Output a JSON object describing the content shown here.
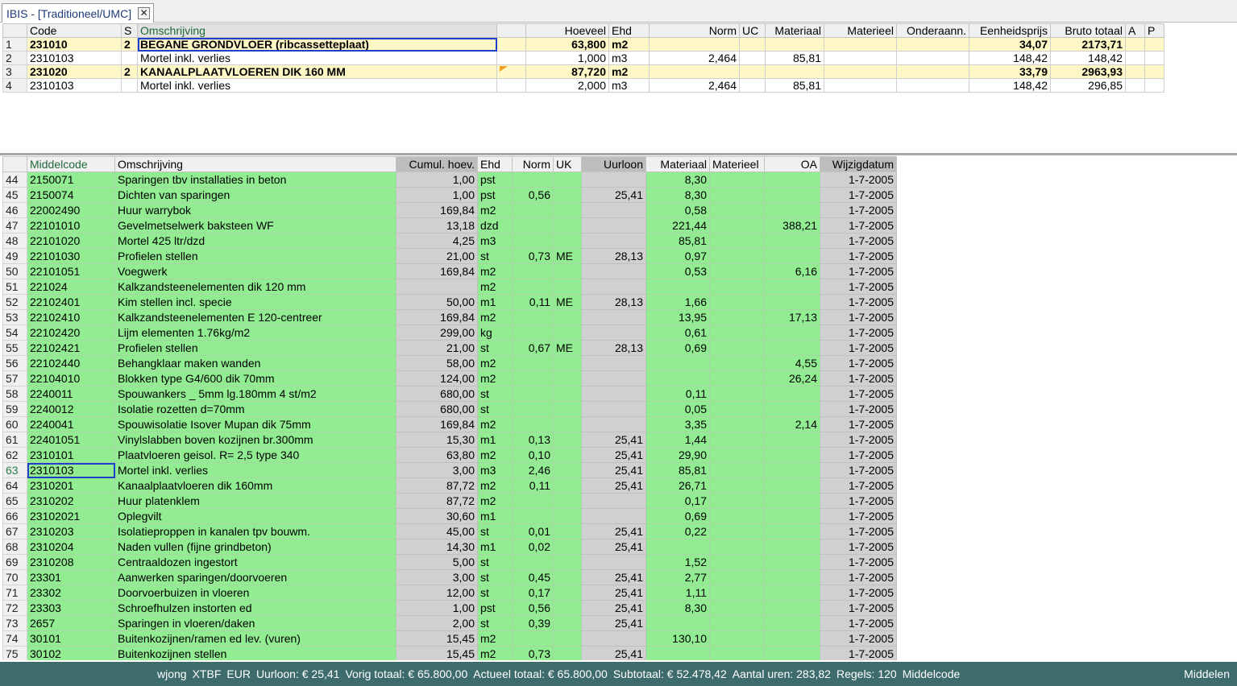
{
  "tab": {
    "title": "IBIS - [Traditioneel/UMC]",
    "close_glyph": "✕",
    "close_icon": "close-icon"
  },
  "upper_grid": {
    "columns": [
      {
        "key": "row",
        "label": "",
        "align": "l",
        "width": 30
      },
      {
        "key": "code",
        "label": "Code",
        "align": "l",
        "width": 117
      },
      {
        "key": "s",
        "label": "S",
        "align": "l",
        "width": 20
      },
      {
        "key": "omschrijving",
        "label": "Omschrijving",
        "align": "l",
        "width": 446,
        "sorted": true
      },
      {
        "key": "marker",
        "label": "",
        "align": "l",
        "width": 36
      },
      {
        "key": "hoeveel",
        "label": "Hoeveel",
        "align": "r",
        "width": 103
      },
      {
        "key": "ehd",
        "label": "Ehd",
        "align": "l",
        "width": 50
      },
      {
        "key": "norm",
        "label": "Norm",
        "align": "r",
        "width": 112
      },
      {
        "key": "uc",
        "label": "UC",
        "align": "l",
        "width": 32
      },
      {
        "key": "materiaal",
        "label": "Materiaal",
        "align": "r",
        "width": 73
      },
      {
        "key": "materieel",
        "label": "Materieel",
        "align": "r",
        "width": 90
      },
      {
        "key": "onderaann",
        "label": "Onderaann.",
        "align": "r",
        "width": 90
      },
      {
        "key": "eenheidsprijs",
        "label": "Eenheidsprijs",
        "align": "r",
        "width": 101
      },
      {
        "key": "bruto_totaal",
        "label": "Bruto totaal",
        "align": "r",
        "width": 93
      },
      {
        "key": "a",
        "label": "A",
        "align": "l",
        "width": 24
      },
      {
        "key": "p",
        "label": "P",
        "align": "l",
        "width": 24
      }
    ],
    "rows": [
      {
        "row": "1",
        "code": "231010",
        "s": "2",
        "omschrijving": "BEGANE GRONDVLOER (ribcassetteplaat)",
        "marker": "",
        "hoeveel": "63,800",
        "ehd": "m2",
        "norm": "",
        "uc": "",
        "materiaal": "",
        "materieel": "",
        "onderaann": "",
        "eenheidsprijs": "34,07",
        "bruto_totaal": "2173,71",
        "a": "",
        "p": "",
        "heading": true,
        "selected": "omschrijving"
      },
      {
        "row": "2",
        "code": "2310103",
        "s": "",
        "omschrijving": "Mortel inkl. verlies",
        "marker": "",
        "hoeveel": "1,000",
        "ehd": "m3",
        "norm": "2,464",
        "uc": "",
        "materiaal": "85,81",
        "materieel": "",
        "onderaann": "",
        "eenheidsprijs": "148,42",
        "bruto_totaal": "148,42",
        "a": "",
        "p": ""
      },
      {
        "row": "3",
        "code": "231020",
        "s": "2",
        "omschrijving": "KANAALPLAATVLOEREN  DIK 160 MM",
        "marker": "note",
        "hoeveel": "87,720",
        "ehd": "m2",
        "norm": "",
        "uc": "",
        "materiaal": "",
        "materieel": "",
        "onderaann": "",
        "eenheidsprijs": "33,79",
        "bruto_totaal": "2963,93",
        "a": "",
        "p": "",
        "heading": true
      },
      {
        "row": "4",
        "code": "2310103",
        "s": "",
        "omschrijving": "Mortel inkl. verlies",
        "marker": "",
        "hoeveel": "2,000",
        "ehd": "m3",
        "norm": "2,464",
        "uc": "",
        "materiaal": "85,81",
        "materieel": "",
        "onderaann": "",
        "eenheidsprijs": "148,42",
        "bruto_totaal": "296,85",
        "a": "",
        "p": ""
      }
    ]
  },
  "lower_grid": {
    "columns": [
      {
        "key": "row",
        "label": "",
        "align": "l",
        "width": 30
      },
      {
        "key": "middelcode",
        "label": "Middelcode",
        "align": "l",
        "width": 109,
        "sorted": true
      },
      {
        "key": "omschrijving",
        "label": "Omschrijving",
        "align": "l",
        "width": 349
      },
      {
        "key": "cumul",
        "label": "Cumul. hoev.",
        "align": "r",
        "width": 101,
        "dark": true
      },
      {
        "key": "ehd",
        "label": "Ehd",
        "align": "l",
        "width": 43
      },
      {
        "key": "norm",
        "label": "Norm",
        "align": "r",
        "width": 51
      },
      {
        "key": "uk",
        "label": "UK",
        "align": "l",
        "width": 35
      },
      {
        "key": "uurloon",
        "label": "Uurloon",
        "align": "r",
        "width": 80,
        "dark": true
      },
      {
        "key": "materiaal",
        "label": "Materiaal",
        "align": "r",
        "width": 79
      },
      {
        "key": "materieel",
        "label": "Materieel",
        "align": "l",
        "width": 68
      },
      {
        "key": "oa",
        "label": "OA",
        "align": "r",
        "width": 69
      },
      {
        "key": "wijzigdatum",
        "label": "Wijzigdatum",
        "align": "r",
        "width": 95,
        "dark": true
      }
    ],
    "rows": [
      {
        "row": "44",
        "middelcode": "2150071",
        "omschrijving": "Sparingen tbv installaties in beton",
        "cumul": "1,00",
        "ehd": "pst",
        "norm": "",
        "uk": "",
        "uurloon": "",
        "materiaal": "8,30",
        "materieel": "",
        "oa": "",
        "wijzigdatum": "1-7-2005"
      },
      {
        "row": "45",
        "middelcode": "2150074",
        "omschrijving": "Dichten van sparingen",
        "cumul": "1,00",
        "ehd": "pst",
        "norm": "0,56",
        "uk": "",
        "uurloon": "25,41",
        "materiaal": "8,30",
        "materieel": "",
        "oa": "",
        "wijzigdatum": "1-7-2005"
      },
      {
        "row": "46",
        "middelcode": "22002490",
        "omschrijving": "Huur warrybok",
        "cumul": "169,84",
        "ehd": "m2",
        "norm": "",
        "uk": "",
        "uurloon": "",
        "materiaal": "0,58",
        "materieel": "",
        "oa": "",
        "wijzigdatum": "1-7-2005"
      },
      {
        "row": "47",
        "middelcode": "22101010",
        "omschrijving": "Gevelmetselwerk baksteen WF",
        "cumul": "13,18",
        "ehd": "dzd",
        "norm": "",
        "uk": "",
        "uurloon": "",
        "materiaal": "221,44",
        "materieel": "",
        "oa": "388,21",
        "wijzigdatum": "1-7-2005"
      },
      {
        "row": "48",
        "middelcode": "22101020",
        "omschrijving": "Mortel 425 ltr/dzd",
        "cumul": "4,25",
        "ehd": "m3",
        "norm": "",
        "uk": "",
        "uurloon": "",
        "materiaal": "85,81",
        "materieel": "",
        "oa": "",
        "wijzigdatum": "1-7-2005"
      },
      {
        "row": "49",
        "middelcode": "22101030",
        "omschrijving": "Profielen stellen",
        "cumul": "21,00",
        "ehd": "st",
        "norm": "0,73",
        "uk": "ME",
        "uurloon": "28,13",
        "materiaal": "0,97",
        "materieel": "",
        "oa": "",
        "wijzigdatum": "1-7-2005"
      },
      {
        "row": "50",
        "middelcode": "22101051",
        "omschrijving": "Voegwerk",
        "cumul": "169,84",
        "ehd": "m2",
        "norm": "",
        "uk": "",
        "uurloon": "",
        "materiaal": "0,53",
        "materieel": "",
        "oa": "6,16",
        "wijzigdatum": "1-7-2005"
      },
      {
        "row": "51",
        "middelcode": "221024",
        "omschrijving": "Kalkzandsteenelementen dik 120 mm",
        "cumul": "",
        "ehd": "m2",
        "norm": "",
        "uk": "",
        "uurloon": "",
        "materiaal": "",
        "materieel": "",
        "oa": "",
        "wijzigdatum": "1-7-2005"
      },
      {
        "row": "52",
        "middelcode": "22102401",
        "omschrijving": "Kim stellen incl. specie",
        "cumul": "50,00",
        "ehd": "m1",
        "norm": "0,11",
        "uk": "ME",
        "uurloon": "28,13",
        "materiaal": "1,66",
        "materieel": "",
        "oa": "",
        "wijzigdatum": "1-7-2005"
      },
      {
        "row": "53",
        "middelcode": "22102410",
        "omschrijving": "Kalkzandsteenelementen E 120-centreer",
        "cumul": "169,84",
        "ehd": "m2",
        "norm": "",
        "uk": "",
        "uurloon": "",
        "materiaal": "13,95",
        "materieel": "",
        "oa": "17,13",
        "wijzigdatum": "1-7-2005"
      },
      {
        "row": "54",
        "middelcode": "22102420",
        "omschrijving": "Lijm elementen 1.76kg/m2",
        "cumul": "299,00",
        "ehd": "kg",
        "norm": "",
        "uk": "",
        "uurloon": "",
        "materiaal": "0,61",
        "materieel": "",
        "oa": "",
        "wijzigdatum": "1-7-2005"
      },
      {
        "row": "55",
        "middelcode": "22102421",
        "omschrijving": "Profielen stellen",
        "cumul": "21,00",
        "ehd": "st",
        "norm": "0,67",
        "uk": "ME",
        "uurloon": "28,13",
        "materiaal": "0,69",
        "materieel": "",
        "oa": "",
        "wijzigdatum": "1-7-2005"
      },
      {
        "row": "56",
        "middelcode": "22102440",
        "omschrijving": "Behangklaar maken wanden",
        "cumul": "58,00",
        "ehd": "m2",
        "norm": "",
        "uk": "",
        "uurloon": "",
        "materiaal": "",
        "materieel": "",
        "oa": "4,55",
        "wijzigdatum": "1-7-2005"
      },
      {
        "row": "57",
        "middelcode": "22104010",
        "omschrijving": "Blokken type G4/600 dik  70mm",
        "cumul": "124,00",
        "ehd": "m2",
        "norm": "",
        "uk": "",
        "uurloon": "",
        "materiaal": "",
        "materieel": "",
        "oa": "26,24",
        "wijzigdatum": "1-7-2005"
      },
      {
        "row": "58",
        "middelcode": "2240011",
        "omschrijving": "Spouwankers _ 5mm lg.180mm      4 st/m2",
        "cumul": "680,00",
        "ehd": "st",
        "norm": "",
        "uk": "",
        "uurloon": "",
        "materiaal": "0,11",
        "materieel": "",
        "oa": "",
        "wijzigdatum": "1-7-2005"
      },
      {
        "row": "59",
        "middelcode": "2240012",
        "omschrijving": "Isolatie rozetten d=70mm",
        "cumul": "680,00",
        "ehd": "st",
        "norm": "",
        "uk": "",
        "uurloon": "",
        "materiaal": "0,05",
        "materieel": "",
        "oa": "",
        "wijzigdatum": "1-7-2005"
      },
      {
        "row": "60",
        "middelcode": "2240041",
        "omschrijving": "Spouwisolatie Isover Mupan  dik 75mm",
        "cumul": "169,84",
        "ehd": "m2",
        "norm": "",
        "uk": "",
        "uurloon": "",
        "materiaal": "3,35",
        "materieel": "",
        "oa": "2,14",
        "wijzigdatum": "1-7-2005"
      },
      {
        "row": "61",
        "middelcode": "22401051",
        "omschrijving": "Vinylslabben  boven kozijnen br.300mm",
        "cumul": "15,30",
        "ehd": "m1",
        "norm": "0,13",
        "uk": "",
        "uurloon": "25,41",
        "materiaal": "1,44",
        "materieel": "",
        "oa": "",
        "wijzigdatum": "1-7-2005"
      },
      {
        "row": "62",
        "middelcode": "2310101",
        "omschrijving": "Plaatvloeren geisol. R= 2,5 type 340",
        "cumul": "63,80",
        "ehd": "m2",
        "norm": "0,10",
        "uk": "",
        "uurloon": "25,41",
        "materiaal": "29,90",
        "materieel": "",
        "oa": "",
        "wijzigdatum": "1-7-2005"
      },
      {
        "row": "63",
        "middelcode": "2310103",
        "omschrijving": "Mortel inkl. verlies",
        "cumul": "3,00",
        "ehd": "m3",
        "norm": "2,46",
        "uk": "",
        "uurloon": "25,41",
        "materiaal": "85,81",
        "materieel": "",
        "oa": "",
        "wijzigdatum": "1-7-2005",
        "current": true,
        "selected": "middelcode"
      },
      {
        "row": "64",
        "middelcode": "2310201",
        "omschrijving": "Kanaalplaatvloeren  dik 160mm",
        "cumul": "87,72",
        "ehd": "m2",
        "norm": "0,11",
        "uk": "",
        "uurloon": "25,41",
        "materiaal": "26,71",
        "materieel": "",
        "oa": "",
        "wijzigdatum": "1-7-2005"
      },
      {
        "row": "65",
        "middelcode": "2310202",
        "omschrijving": "Huur platenklem",
        "cumul": "87,72",
        "ehd": "m2",
        "norm": "",
        "uk": "",
        "uurloon": "",
        "materiaal": "0,17",
        "materieel": "",
        "oa": "",
        "wijzigdatum": "1-7-2005"
      },
      {
        "row": "66",
        "middelcode": "23102021",
        "omschrijving": "Oplegvilt",
        "cumul": "30,60",
        "ehd": "m1",
        "norm": "",
        "uk": "",
        "uurloon": "",
        "materiaal": "0,69",
        "materieel": "",
        "oa": "",
        "wijzigdatum": "1-7-2005"
      },
      {
        "row": "67",
        "middelcode": "2310203",
        "omschrijving": "Isolatieproppen in kanalen tpv bouwm.",
        "cumul": "45,00",
        "ehd": "st",
        "norm": "0,01",
        "uk": "",
        "uurloon": "25,41",
        "materiaal": "0,22",
        "materieel": "",
        "oa": "",
        "wijzigdatum": "1-7-2005"
      },
      {
        "row": "68",
        "middelcode": "2310204",
        "omschrijving": "Naden vullen (fijne grindbeton)",
        "cumul": "14,30",
        "ehd": "m1",
        "norm": "0,02",
        "uk": "",
        "uurloon": "25,41",
        "materiaal": "",
        "materieel": "",
        "oa": "",
        "wijzigdatum": "1-7-2005"
      },
      {
        "row": "69",
        "middelcode": "2310208",
        "omschrijving": "Centraaldozen ingestort",
        "cumul": "5,00",
        "ehd": "st",
        "norm": "",
        "uk": "",
        "uurloon": "",
        "materiaal": "1,52",
        "materieel": "",
        "oa": "",
        "wijzigdatum": "1-7-2005"
      },
      {
        "row": "70",
        "middelcode": "23301",
        "omschrijving": "Aanwerken sparingen/doorvoeren",
        "cumul": "3,00",
        "ehd": "st",
        "norm": "0,45",
        "uk": "",
        "uurloon": "25,41",
        "materiaal": "2,77",
        "materieel": "",
        "oa": "",
        "wijzigdatum": "1-7-2005"
      },
      {
        "row": "71",
        "middelcode": "23302",
        "omschrijving": "Doorvoerbuizen in vloeren",
        "cumul": "12,00",
        "ehd": "st",
        "norm": "0,17",
        "uk": "",
        "uurloon": "25,41",
        "materiaal": "1,11",
        "materieel": "",
        "oa": "",
        "wijzigdatum": "1-7-2005"
      },
      {
        "row": "72",
        "middelcode": "23303",
        "omschrijving": "Schroefhulzen instorten ed",
        "cumul": "1,00",
        "ehd": "pst",
        "norm": "0,56",
        "uk": "",
        "uurloon": "25,41",
        "materiaal": "8,30",
        "materieel": "",
        "oa": "",
        "wijzigdatum": "1-7-2005"
      },
      {
        "row": "73",
        "middelcode": "2657",
        "omschrijving": "Sparingen in vloeren/daken",
        "cumul": "2,00",
        "ehd": "st",
        "norm": "0,39",
        "uk": "",
        "uurloon": "25,41",
        "materiaal": "",
        "materieel": "",
        "oa": "",
        "wijzigdatum": "1-7-2005"
      },
      {
        "row": "74",
        "middelcode": "30101",
        "omschrijving": "Buitenkozijnen/ramen ed lev. (vuren)",
        "cumul": "15,45",
        "ehd": "m2",
        "norm": "",
        "uk": "",
        "uurloon": "",
        "materiaal": "130,10",
        "materieel": "",
        "oa": "",
        "wijzigdatum": "1-7-2005"
      },
      {
        "row": "75",
        "middelcode": "30102",
        "omschrijving": "Buitenkozijnen stellen",
        "cumul": "15,45",
        "ehd": "m2",
        "norm": "0,73",
        "uk": "",
        "uurloon": "25,41",
        "materiaal": "",
        "materieel": "",
        "oa": "",
        "wijzigdatum": "1-7-2005"
      }
    ]
  },
  "status_bar": {
    "items": [
      "wjong",
      "XTBF",
      "EUR",
      "Uurloon: € 25,41",
      "Vorig totaal: € 65.800,00",
      "Actueel totaal: € 65.800,00",
      "Subtotaal: € 52.478,42",
      "Aantal uren: 283,82",
      "Regels: 120",
      "Middelcode"
    ],
    "right": "Middelen"
  },
  "colors": {
    "row_green": "#92ec92",
    "heading_yellow": "#fff8c6",
    "selection_blue": "#1e3fc8",
    "statusbar": "#3e6b6b",
    "sorted_header_text": "#20683a"
  }
}
